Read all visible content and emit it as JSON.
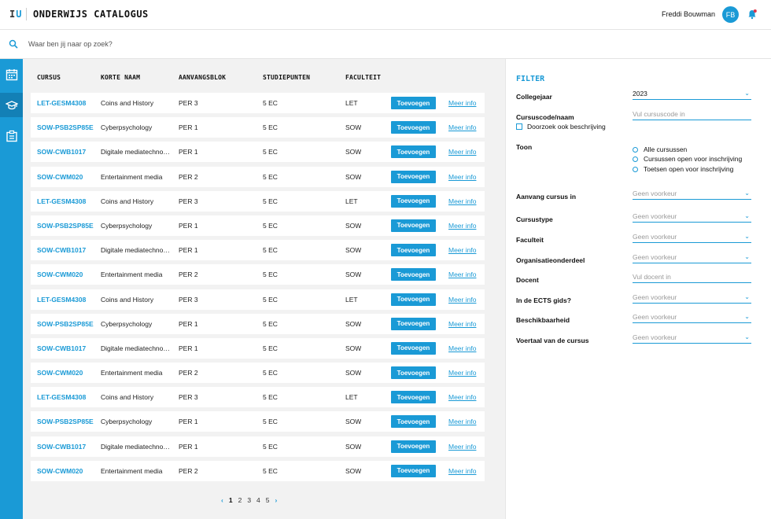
{
  "header": {
    "logo_left": "I",
    "logo_right": "U",
    "title": "ONDERWIJS CATALOGUS",
    "user_name": "Freddi Bouwman",
    "avatar_initials": "FB"
  },
  "search": {
    "placeholder": "Waar ben jij naar op zoek?"
  },
  "rail": {
    "items": [
      "calendar-icon",
      "graduation-cap-icon",
      "clipboard-icon"
    ],
    "active_index": 1
  },
  "colors": {
    "accent": "#1a9ad6",
    "accent_dark": "#1380b6",
    "panel_bg": "#f2f2f2"
  },
  "table": {
    "headers": [
      "Cursus",
      "Korte naam",
      "Aanvangsblok",
      "Studiepunten",
      "Faculteit"
    ],
    "add_label": "Toevoegen",
    "more_label": "Meer info",
    "rows": [
      [
        "LET-GESM4308",
        "Coins and History",
        "PER 3",
        "5 EC",
        "LET"
      ],
      [
        "SOW-PSB2SP85E",
        "Cyberpsychology",
        "PER 1",
        "5 EC",
        "SOW"
      ],
      [
        "SOW-CWB1017",
        "Digitale mediatechnologie",
        "PER 1",
        "5 EC",
        "SOW"
      ],
      [
        "SOW-CWM020",
        "Entertainment media",
        "PER 2",
        "5 EC",
        "SOW"
      ],
      [
        "LET-GESM4308",
        "Coins and History",
        "PER 3",
        "5 EC",
        "LET"
      ],
      [
        "SOW-PSB2SP85E",
        "Cyberpsychology",
        "PER 1",
        "5 EC",
        "SOW"
      ],
      [
        "SOW-CWB1017",
        "Digitale mediatechnologie",
        "PER 1",
        "5 EC",
        "SOW"
      ],
      [
        "SOW-CWM020",
        "Entertainment media",
        "PER 2",
        "5 EC",
        "SOW"
      ],
      [
        "LET-GESM4308",
        "Coins and History",
        "PER 3",
        "5 EC",
        "LET"
      ],
      [
        "SOW-PSB2SP85E",
        "Cyberpsychology",
        "PER 1",
        "5 EC",
        "SOW"
      ],
      [
        "SOW-CWB1017",
        "Digitale mediatechnologie",
        "PER 1",
        "5 EC",
        "SOW"
      ],
      [
        "SOW-CWM020",
        "Entertainment media",
        "PER 2",
        "5 EC",
        "SOW"
      ],
      [
        "LET-GESM4308",
        "Coins and History",
        "PER 3",
        "5 EC",
        "LET"
      ],
      [
        "SOW-PSB2SP85E",
        "Cyberpsychology",
        "PER 1",
        "5 EC",
        "SOW"
      ],
      [
        "SOW-CWB1017",
        "Digitale mediatechnologie",
        "PER 1",
        "5 EC",
        "SOW"
      ],
      [
        "SOW-CWM020",
        "Entertainment media",
        "PER 2",
        "5 EC",
        "SOW"
      ]
    ]
  },
  "pagination": {
    "prev": "‹",
    "next": "›",
    "pages": [
      "1",
      "2",
      "3",
      "4",
      "5"
    ],
    "current": "1"
  },
  "filter": {
    "title": "FILTER",
    "collegejaar_label": "Collegejaar",
    "collegejaar_value": "2023",
    "cursuscode_label": "Cursuscode/naam",
    "cursuscode_placeholder": "Vul cursuscode in",
    "doorzoek_label": "Doorzoek ook beschrijving",
    "toon_label": "Toon",
    "toon_options": [
      "Alle cursussen",
      "Cursussen open voor inschrijving",
      "Toetsen open voor inschrijving"
    ],
    "fields": [
      {
        "label": "Aanvang cursus in",
        "placeholder": "Geen voorkeur",
        "dropdown": true
      },
      {
        "label": "Cursustype",
        "placeholder": "Geen voorkeur",
        "dropdown": true
      },
      {
        "label": "Faculteit",
        "placeholder": "Geen voorkeur",
        "dropdown": true
      },
      {
        "label": "Organisatieonderdeel",
        "placeholder": "Geen voorkeur",
        "dropdown": true
      },
      {
        "label": "Docent",
        "placeholder": "Vul docent in",
        "dropdown": false
      },
      {
        "label": "In de ECTS gids?",
        "placeholder": "Geen voorkeur",
        "dropdown": true
      },
      {
        "label": "Beschikbaarheid",
        "placeholder": "Geen voorkeur",
        "dropdown": true
      },
      {
        "label": "Voertaal van de cursus",
        "placeholder": "Geen voorkeur",
        "dropdown": true
      }
    ]
  }
}
